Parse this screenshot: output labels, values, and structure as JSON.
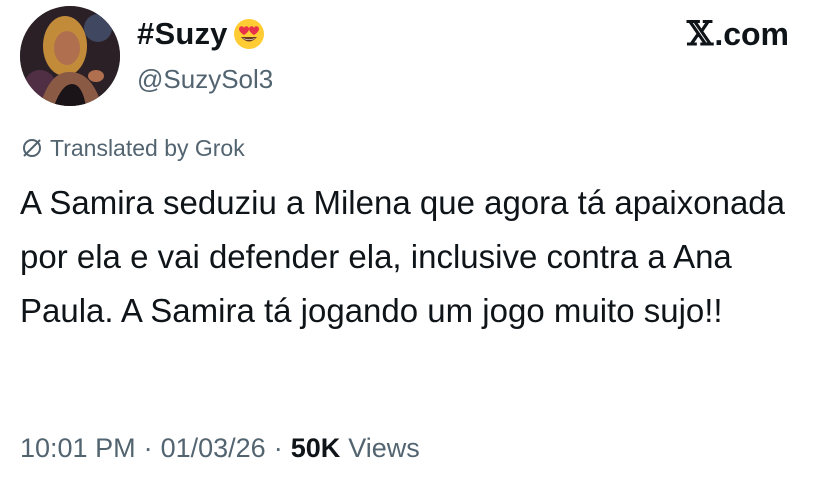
{
  "author": {
    "display_name": "#Suzy",
    "emoji_icon": "heart-eyes-emoji",
    "handle": "@SuzySol3"
  },
  "site": {
    "logo_letter": "𝕏",
    "logo_domain": ".com"
  },
  "translation": {
    "label": "Translated by Grok",
    "icon": "translate-slash-icon"
  },
  "tweet": {
    "text": "A Samira seduziu a Milena que agora tá apaixonada por ela e vai defender ela, inclusive contra a Ana Paula. A Samira tá jogando um jogo muito sujo!!"
  },
  "meta": {
    "time": "10:01 PM",
    "separator": "·",
    "date": "01/03/26",
    "views_count": "50K",
    "views_label": "Views"
  },
  "colors": {
    "text_primary": "#0f1419",
    "text_secondary": "#536471",
    "background": "#ffffff"
  }
}
